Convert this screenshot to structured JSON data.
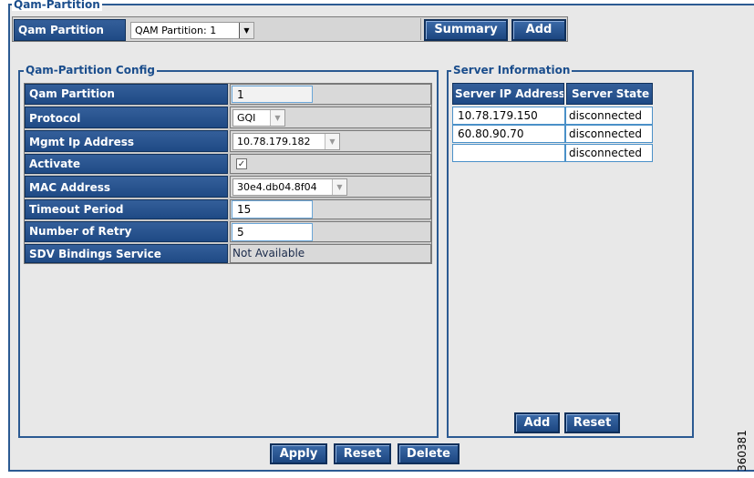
{
  "qam_partition": {
    "legend": "Qam-Partition",
    "label": "Qam Partition",
    "selected": "QAM Partition: 1",
    "summary_label": "Summary",
    "add_label": "Add"
  },
  "config": {
    "legend": "Qam-Partition Config",
    "rows": [
      {
        "label": "Qam Partition",
        "value": "1"
      },
      {
        "label": "Protocol",
        "value": "GQI"
      },
      {
        "label": "Mgmt Ip Address",
        "value": "10.78.179.182"
      },
      {
        "label": "Activate",
        "checked": true
      },
      {
        "label": "MAC Address",
        "value": "30e4.db04.8f04"
      },
      {
        "label": "Timeout Period",
        "value": "15"
      },
      {
        "label": "Number of Retry",
        "value": "5"
      },
      {
        "label": "SDV Bindings Service",
        "value": "Not Available"
      }
    ]
  },
  "server_info": {
    "legend": "Server Information",
    "columns": [
      "Server IP Address",
      "Server State"
    ],
    "rows": [
      {
        "ip": "10.78.179.150",
        "state": "disconnected"
      },
      {
        "ip": "60.80.90.70",
        "state": "disconnected"
      },
      {
        "ip": "",
        "state": "disconnected"
      }
    ],
    "add_label": "Add",
    "reset_label": "Reset"
  },
  "footer": {
    "apply_label": "Apply",
    "reset_label": "Reset",
    "delete_label": "Delete"
  },
  "figure_number": "360381"
}
